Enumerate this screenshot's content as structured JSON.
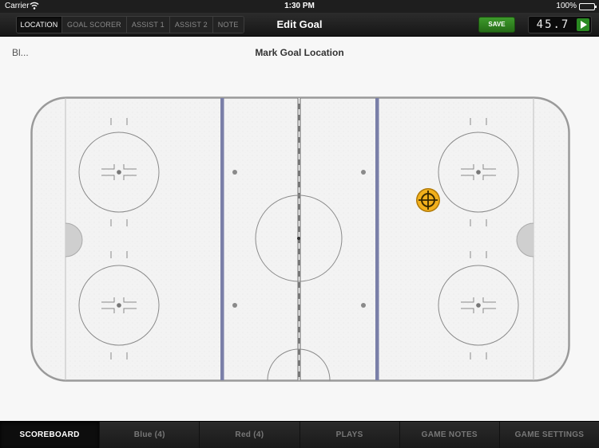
{
  "status_bar": {
    "carrier": "Carrier",
    "time": "1:30 PM",
    "battery": "100%"
  },
  "nav": {
    "segments": [
      {
        "label": "LOCATION",
        "active": true
      },
      {
        "label": "GOAL SCORER",
        "active": false
      },
      {
        "label": "ASSIST 1",
        "active": false
      },
      {
        "label": "ASSIST 2",
        "active": false
      },
      {
        "label": "NOTE",
        "active": false
      }
    ],
    "title": "Edit Goal",
    "save_label": "SAVE",
    "clock": "45.7"
  },
  "content": {
    "team_label": "Bl...",
    "title": "Mark Goal Location"
  },
  "tabs": [
    {
      "label": "SCOREBOARD",
      "active": true
    },
    {
      "label": "Blue (4)",
      "active": false
    },
    {
      "label": "Red (4)",
      "active": false
    },
    {
      "label": "PLAYS",
      "active": false
    },
    {
      "label": "GAME NOTES",
      "active": false
    },
    {
      "label": "GAME SETTINGS",
      "active": false
    }
  ],
  "colors": {
    "blue_line": "#7a7fa8",
    "marker": "#f2b01c",
    "save": "#2f8a22"
  }
}
